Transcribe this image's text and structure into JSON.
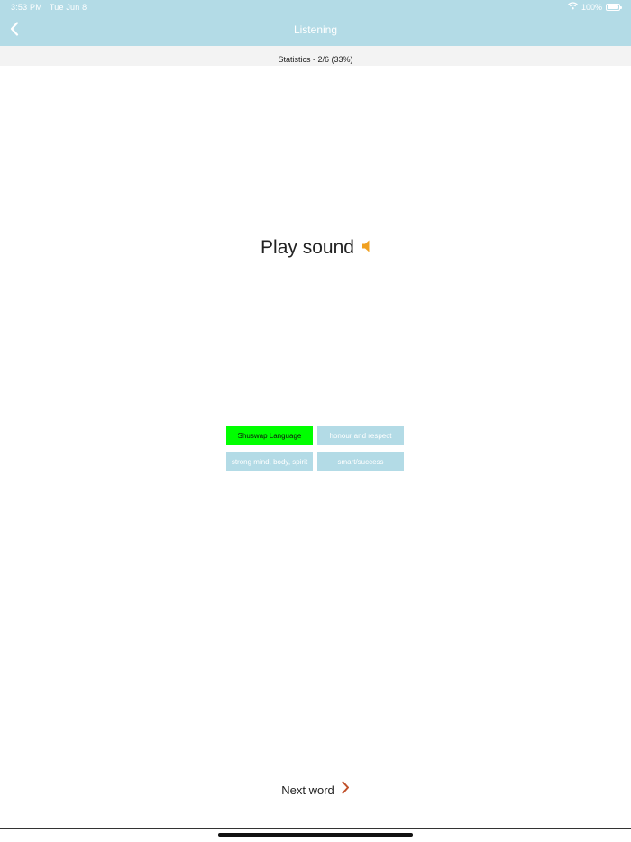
{
  "status_bar": {
    "time": "3:53 PM",
    "date": "Tue Jun 8",
    "battery": "100%",
    "battery_level": 1.0,
    "icons": [
      "wifi-icon",
      "battery-icon"
    ]
  },
  "nav": {
    "title": "Listening",
    "back_icon": "chevron-left-icon"
  },
  "stats": {
    "text": "Statistics - 2/6 (33%)"
  },
  "prompt": {
    "label": "Play sound",
    "icon": "speaker-icon"
  },
  "answers": [
    {
      "label": "Shuswap Language",
      "state": "correct"
    },
    {
      "label": "honour and respect",
      "state": "default"
    },
    {
      "label": "strong mind, body, spirit",
      "state": "default"
    },
    {
      "label": "smart/success",
      "state": "default"
    }
  ],
  "footer": {
    "next_label": "Next word",
    "next_icon": "chevron-right-icon"
  },
  "colors": {
    "header": "#b3dbe6",
    "answer_default": "#b3dbe6",
    "answer_correct": "#00ff00",
    "speaker": "#f0a020",
    "next_chevron": "#c0502a"
  }
}
